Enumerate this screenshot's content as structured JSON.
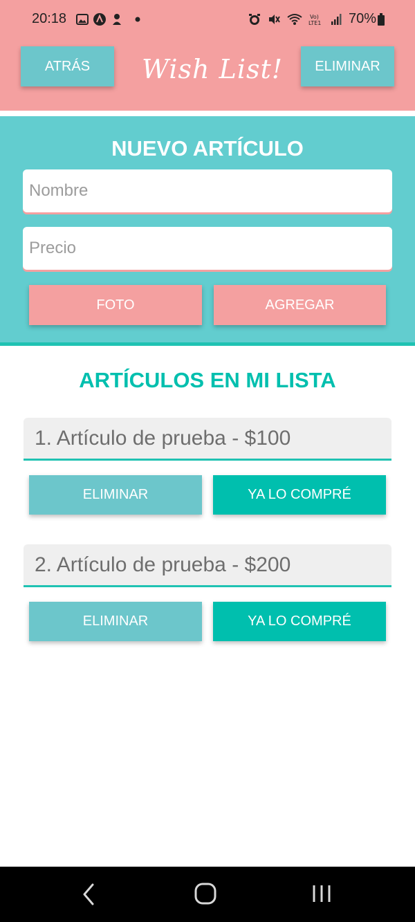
{
  "status_bar": {
    "time": "20:18",
    "battery": "70%",
    "left_icons": [
      "image-icon",
      "app-icon",
      "character-icon",
      "dot-icon"
    ],
    "right_icons": [
      "alarm-icon",
      "mute-icon",
      "wifi-icon",
      "volte-icon",
      "signal-icon",
      "battery-icon"
    ]
  },
  "header": {
    "back_label": "ATRÁS",
    "title": "Wish List!",
    "delete_label": "ELIMINAR"
  },
  "new_item": {
    "heading": "NUEVO ARTÍCULO",
    "name_placeholder": "Nombre",
    "price_placeholder": "Precio",
    "photo_label": "FOTO",
    "add_label": "AGREGAR"
  },
  "list": {
    "heading": "ARTÍCULOS EN MI LISTA",
    "items": [
      {
        "text": "1. Artículo de prueba  - $100",
        "delete_label": "ELIMINAR",
        "bought_label": "YA LO COMPRÉ"
      },
      {
        "text": "2. Artículo de prueba  - $200",
        "delete_label": "ELIMINAR",
        "bought_label": "YA LO COMPRÉ"
      }
    ]
  },
  "nav_bar": {
    "icons": [
      "back-icon",
      "home-icon",
      "recents-icon"
    ]
  },
  "colors": {
    "header_pink": "#f4a0a0",
    "teal": "#62cdcf",
    "button_teal": "#6cc6cb",
    "green": "#00bfae"
  }
}
